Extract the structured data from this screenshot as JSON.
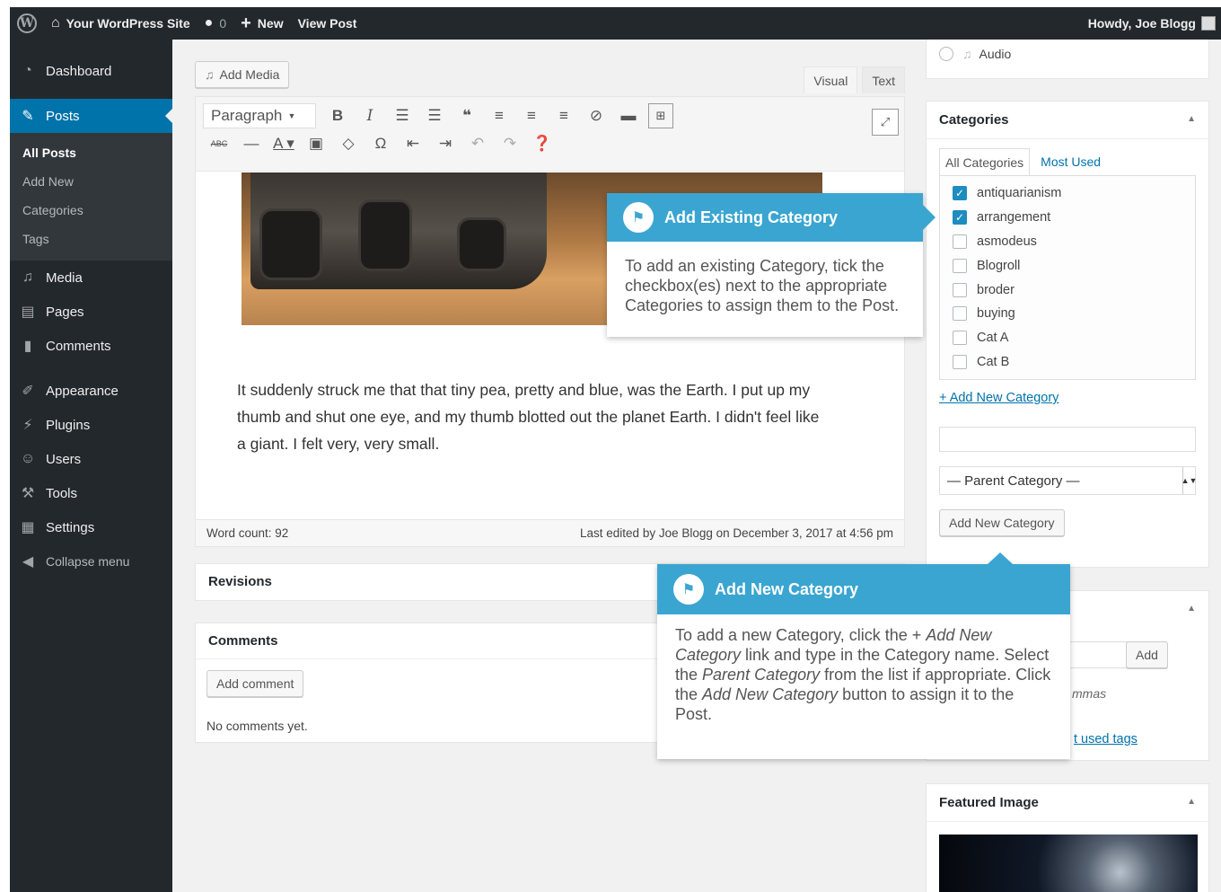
{
  "adminbar": {
    "site_name": "Your WordPress Site",
    "comments_count": "0",
    "new_label": "New",
    "view_post_label": "View Post",
    "howdy": "Howdy, Joe Blogg"
  },
  "sidebar": {
    "dashboard": "Dashboard",
    "posts": "Posts",
    "submenu": [
      "All Posts",
      "Add New",
      "Categories",
      "Tags"
    ],
    "media": "Media",
    "pages": "Pages",
    "comments": "Comments",
    "appearance": "Appearance",
    "plugins": "Plugins",
    "users": "Users",
    "tools": "Tools",
    "settings": "Settings",
    "collapse": "Collapse menu"
  },
  "editor": {
    "add_media": "Add Media",
    "tab_visual": "Visual",
    "tab_text": "Text",
    "format_select": "Paragraph",
    "body_text": "It suddenly struck me that that tiny pea, pretty and blue, was the Earth. I put up my thumb and shut one eye, and my thumb blotted out the planet Earth. I didn't feel like a giant. I felt very, very small.",
    "word_count": "Word count: 92",
    "last_edited": "Last edited by Joe Blogg on December 3, 2017 at 4:56 pm"
  },
  "revisions": {
    "title": "Revisions"
  },
  "comments_box": {
    "title": "Comments",
    "add_button": "Add comment",
    "empty": "No comments yet."
  },
  "format_box": {
    "audio_label": "Audio"
  },
  "categories": {
    "title": "Categories",
    "tab_all": "All Categories",
    "tab_most_used": "Most Used",
    "items": [
      {
        "label": "antiquarianism",
        "checked": true
      },
      {
        "label": "arrangement",
        "checked": true
      },
      {
        "label": "asmodeus",
        "checked": false
      },
      {
        "label": "Blogroll",
        "checked": false
      },
      {
        "label": "broder",
        "checked": false
      },
      {
        "label": "buying",
        "checked": false
      },
      {
        "label": "Cat A",
        "checked": false
      },
      {
        "label": "Cat B",
        "checked": false
      }
    ],
    "add_new_link": "+ Add New Category",
    "parent_select": "— Parent Category —",
    "add_new_button": "Add New Category"
  },
  "tags_box": {
    "add_button": "Add",
    "hint_fragment": "mmas",
    "link_fragment": "t used tags"
  },
  "featured_image": {
    "title": "Featured Image"
  },
  "callout_existing": {
    "title": "Add Existing Category",
    "body": "To add an existing Category, tick the checkbox(es) next to the appropriate Categories to assign them to the Post."
  },
  "callout_new": {
    "title": "Add New Category",
    "t1": "To add a new Category, click the + ",
    "t1_em": "Add New Category",
    "t2": " link and type in the Category name. Select the ",
    "t2_em": "Parent Category",
    "t3": " from the list if appropriate. Click the ",
    "t3_em": "Add New Category",
    "t4": " button to assign it to the Post."
  },
  "colors": {
    "adminbar": "#23282d",
    "accent": "#0073aa",
    "callout": "#3aa5d1"
  }
}
